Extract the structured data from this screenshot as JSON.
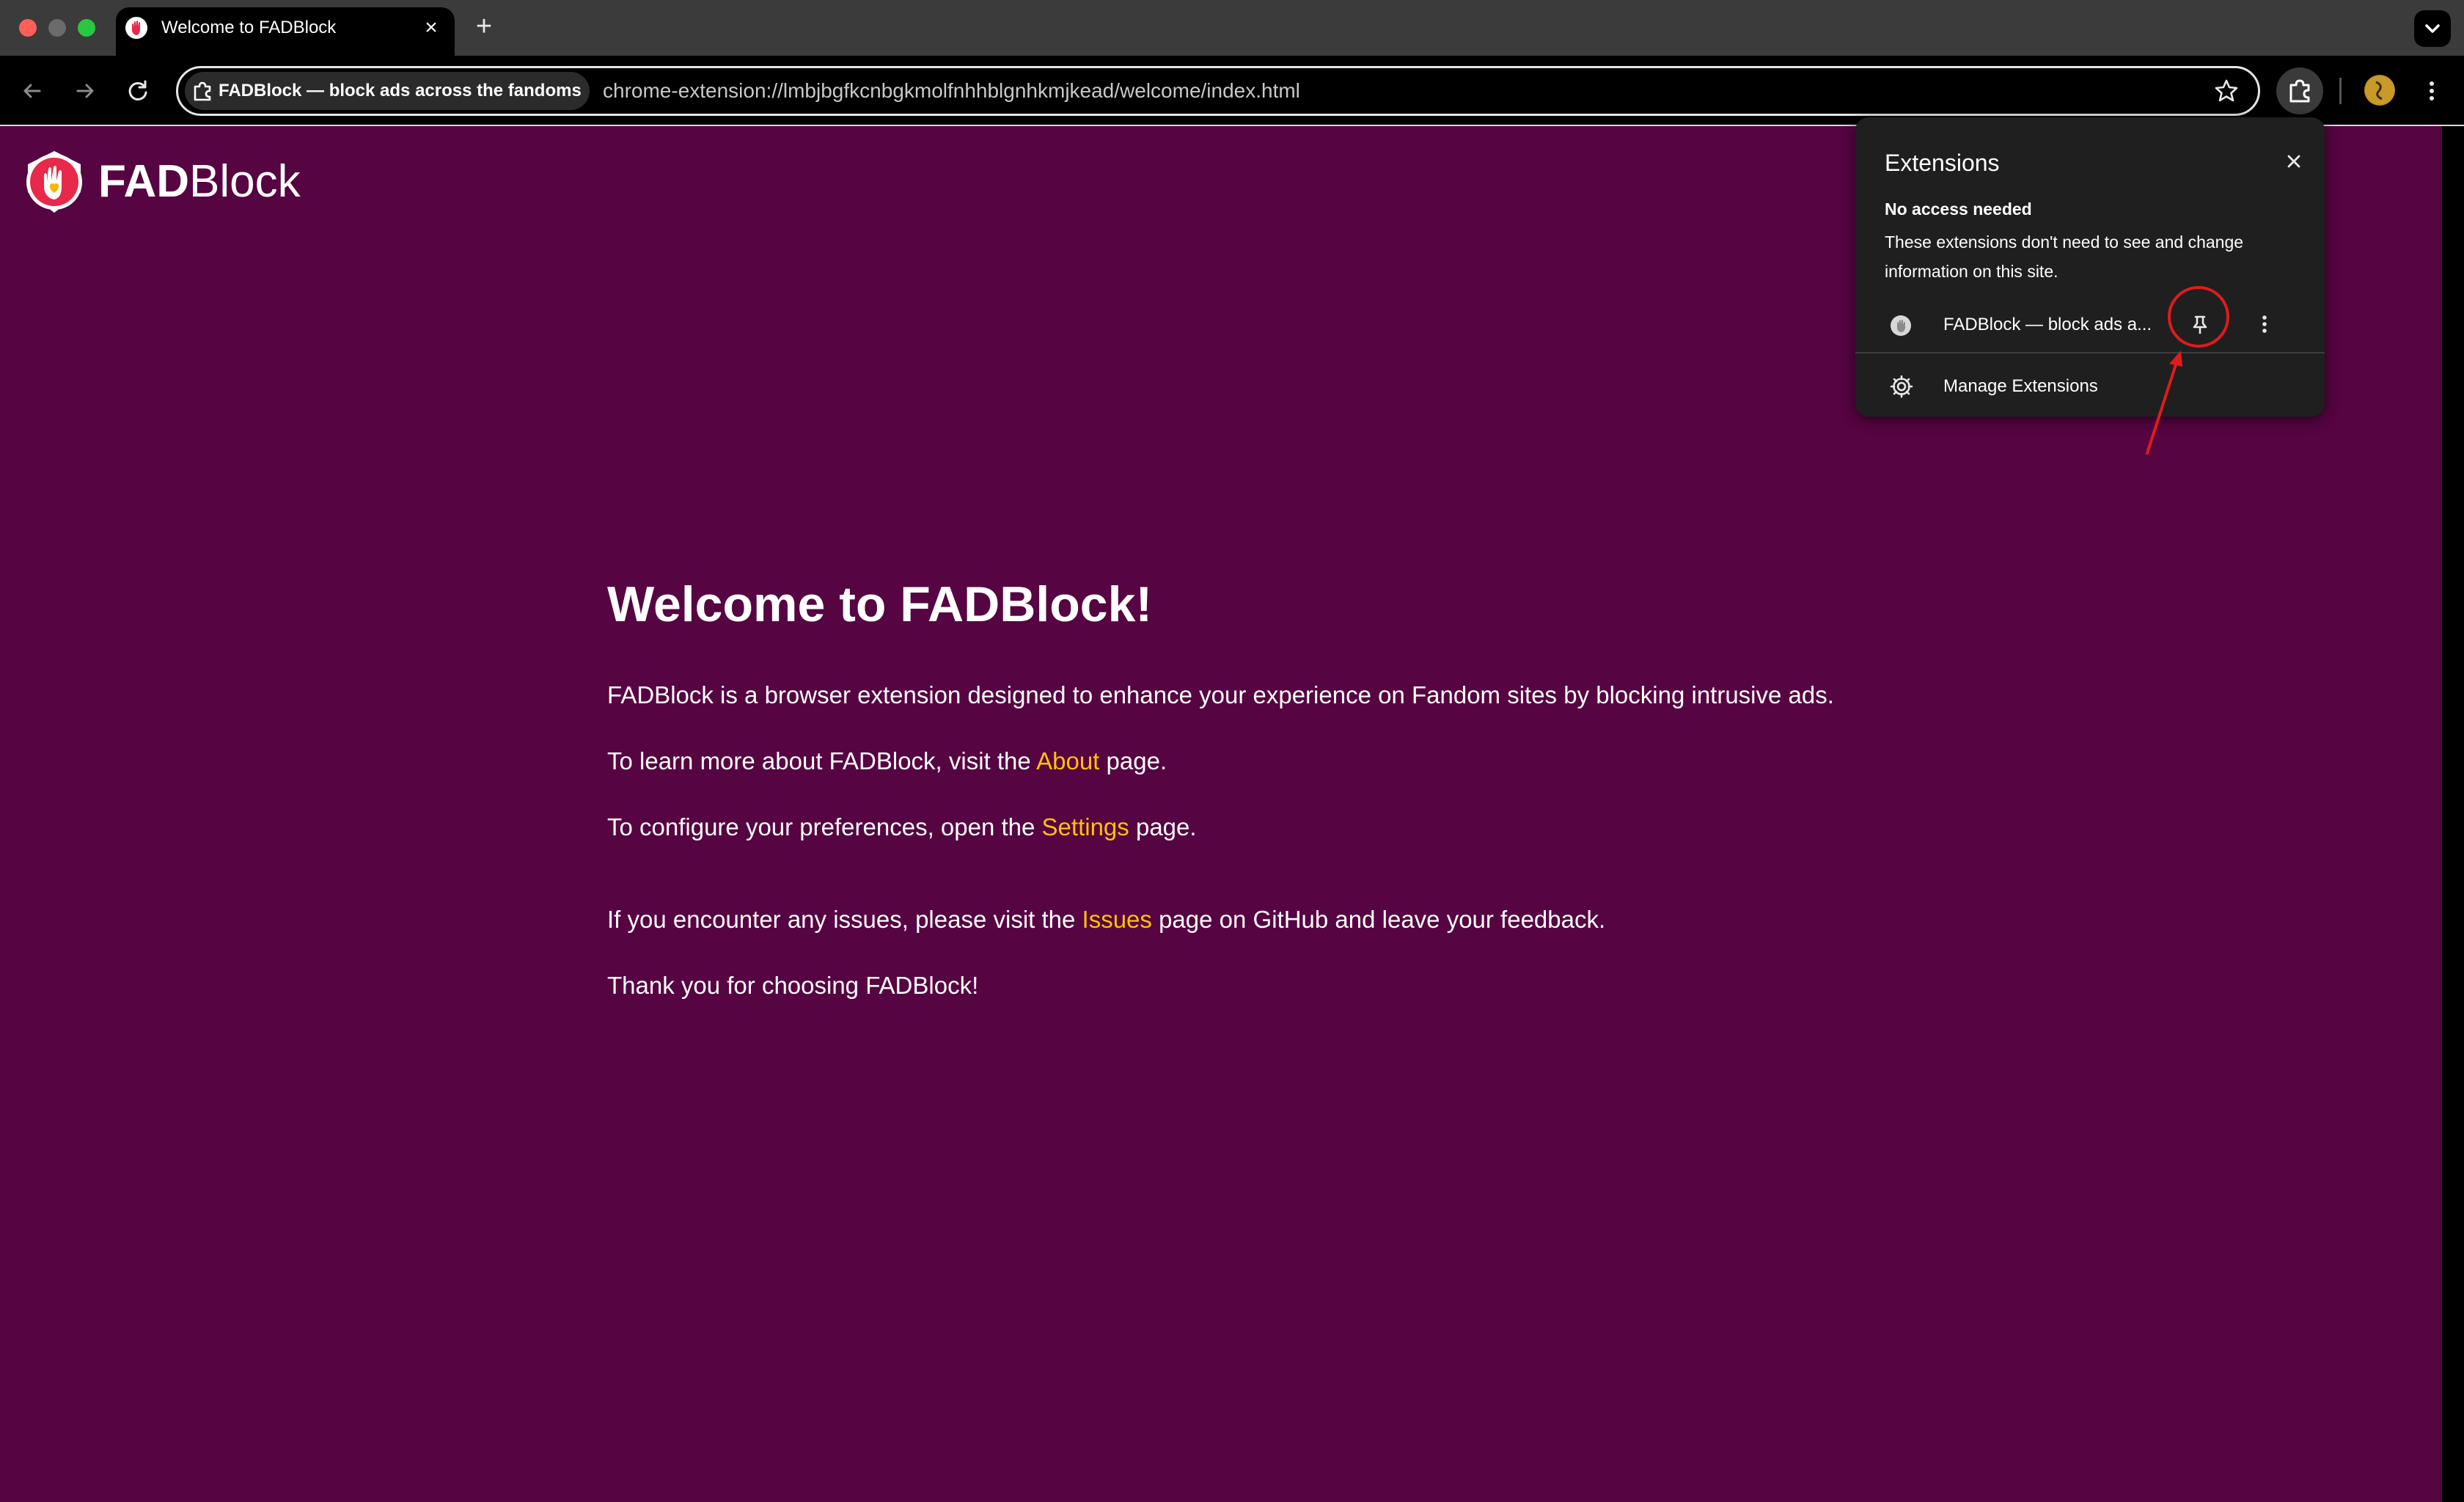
{
  "browser": {
    "tab": {
      "title": "Welcome to FADBlock",
      "close_icon": "close-icon"
    },
    "new_tab_icon": "plus-icon",
    "omnibox": {
      "chip_label": "FADBlock — block ads across the fandoms",
      "url": "chrome-extension://lmbjbgfkcnbgkmolfnhhblgnhkmjkead/welcome/index.html"
    }
  },
  "page": {
    "brand_bold": "FAD",
    "brand_rest": "Block",
    "heading": "Welcome to FADBlock!",
    "intro": "FADBlock is a browser extension designed to enhance your experience on Fandom sites by blocking intrusive ads.",
    "about_pre": "To learn more about FADBlock, visit the ",
    "about_link": "About",
    "about_post": " page.",
    "settings_pre": "To configure your preferences, open the ",
    "settings_link": "Settings",
    "settings_post": " page.",
    "issues_pre": "If you encounter any issues, please visit the ",
    "issues_link": "Issues",
    "issues_post": " page on GitHub and leave your feedback.",
    "thanks": "Thank you for choosing FADBlock!"
  },
  "extensions_popup": {
    "title": "Extensions",
    "section_title": "No access needed",
    "section_desc": "These extensions don't need to see and change information on this site.",
    "extension_name": "FADBlock — block ads a...",
    "manage_label": "Manage Extensions"
  },
  "colors": {
    "page_background": "#560442",
    "link": "#ffc107",
    "annotation": "#e01b1b"
  }
}
